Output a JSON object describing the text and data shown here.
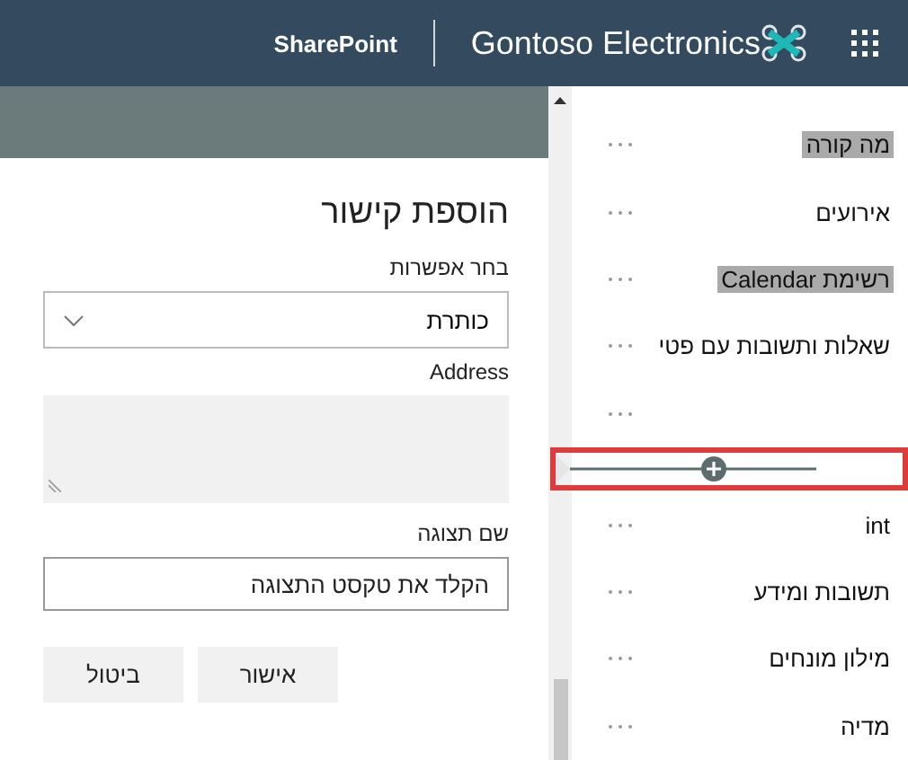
{
  "header": {
    "site_title": "Gontoso Electronics",
    "app_name": "SharePoint"
  },
  "panel": {
    "title": "הוספת קישור",
    "choice_label": "בחר אפשרות",
    "choice_value": "כותרת",
    "address_label": "Address",
    "display_label": "שם תצוגה",
    "display_placeholder": "הקלד את טקסט התצוגה",
    "buttons": [
      "אישור",
      "ביטול"
    ]
  },
  "nav": {
    "items": [
      {
        "kind": "link",
        "label": "מה קורה",
        "highlighted": true
      },
      {
        "kind": "link",
        "label": "אירועים",
        "highlighted": false
      },
      {
        "kind": "link",
        "label": "רשימת Calendar",
        "highlighted": true
      },
      {
        "kind": "link",
        "label": "שאלות ותשובות עם פטי",
        "highlighted": false
      },
      {
        "kind": "blank"
      },
      {
        "kind": "insert"
      },
      {
        "kind": "link",
        "label": "int",
        "highlighted": false
      },
      {
        "kind": "link",
        "label": "תשובות ומידע",
        "highlighted": false
      },
      {
        "kind": "link",
        "label": "מילון מונחים",
        "highlighted": false
      },
      {
        "kind": "link",
        "label": "מדיה",
        "highlighted": false
      }
    ]
  }
}
